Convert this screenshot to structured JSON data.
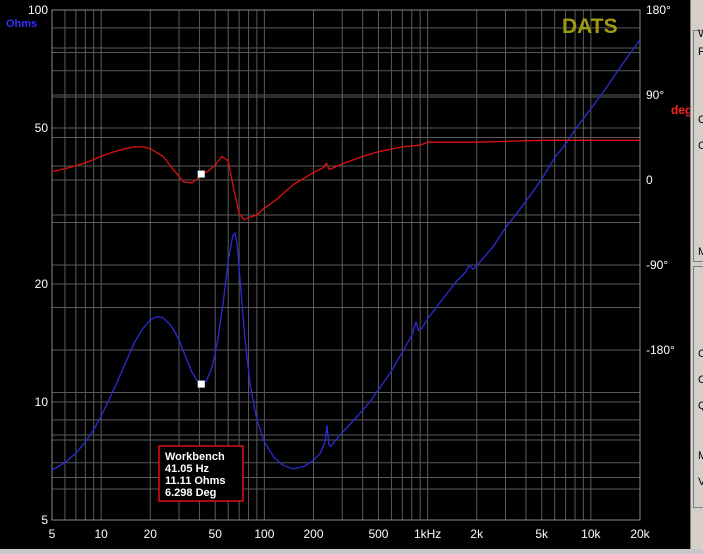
{
  "colors": {
    "impedance": "#2b2bd8",
    "phase": "#e01010",
    "grid": "#5a5a5a",
    "background": "#000000",
    "axis_text": "#ffffff",
    "ohms_label": "#3030ff",
    "deg_label": "#ff2020",
    "brand": "#a09a10",
    "cursor_box_border": "#e01010"
  },
  "chart": {
    "brand": "DATS",
    "y_left_unit": "Ohms",
    "y_right_unit": "deg",
    "left_ticks": [
      "100",
      "50",
      "20",
      "10",
      "5"
    ],
    "right_ticks": [
      "180°",
      "90°",
      "0",
      "-90°",
      "-180°"
    ],
    "x_ticks": [
      "5",
      "10",
      "20",
      "50",
      "100",
      "200",
      "500",
      "1kHz",
      "2k",
      "5k",
      "10k",
      "20k"
    ]
  },
  "cursor": {
    "title": "Workbench",
    "frequency": "41.05 Hz",
    "impedance": "11.11 Ohms",
    "phase": "6.298 Deg"
  },
  "side_panel": {
    "letters": [
      "W",
      "F",
      "C",
      "C",
      "M",
      "C",
      "C",
      "Q",
      "M",
      "V"
    ]
  },
  "chart_data": {
    "type": "line",
    "x_scale": "log",
    "xlim": [
      5,
      20000
    ],
    "ylim_left": [
      5,
      100
    ],
    "ylim_right": [
      -360,
      180
    ],
    "y_left_scale": "log",
    "grid": true,
    "series": [
      {
        "axis": "left",
        "points": [
          [
            5,
            6.7
          ],
          [
            6,
            7.0
          ],
          [
            7,
            7.4
          ],
          [
            8,
            7.9
          ],
          [
            9,
            8.5
          ],
          [
            10,
            9.2
          ],
          [
            12,
            10.8
          ],
          [
            14,
            12.5
          ],
          [
            16,
            14.2
          ],
          [
            18,
            15.4
          ],
          [
            20,
            16.2
          ],
          [
            22,
            16.5
          ],
          [
            24,
            16.4
          ],
          [
            27,
            15.6
          ],
          [
            30,
            14.4
          ],
          [
            33,
            13.0
          ],
          [
            36,
            11.9
          ],
          [
            39,
            11.3
          ],
          [
            41.05,
            11.11
          ],
          [
            44,
            11.3
          ],
          [
            48,
            12.3
          ],
          [
            52,
            14.5
          ],
          [
            56,
            18.0
          ],
          [
            60,
            23.0
          ],
          [
            64,
            26.5
          ],
          [
            66,
            27.0
          ],
          [
            68,
            25.5
          ],
          [
            72,
            19.0
          ],
          [
            76,
            14.5
          ],
          [
            82,
            11.0
          ],
          [
            90,
            9.0
          ],
          [
            100,
            7.9
          ],
          [
            115,
            7.2
          ],
          [
            130,
            6.9
          ],
          [
            150,
            6.75
          ],
          [
            175,
            6.85
          ],
          [
            200,
            7.1
          ],
          [
            220,
            7.4
          ],
          [
            235,
            7.9
          ],
          [
            242,
            8.7
          ],
          [
            248,
            7.8
          ],
          [
            255,
            7.7
          ],
          [
            280,
            8.1
          ],
          [
            320,
            8.6
          ],
          [
            380,
            9.3
          ],
          [
            450,
            10.1
          ],
          [
            520,
            11.0
          ],
          [
            600,
            12.0
          ],
          [
            700,
            13.4
          ],
          [
            800,
            14.8
          ],
          [
            850,
            16.0
          ],
          [
            880,
            15.2
          ],
          [
            920,
            15.4
          ],
          [
            1000,
            16.3
          ],
          [
            1200,
            18.0
          ],
          [
            1500,
            20.3
          ],
          [
            1700,
            21.4
          ],
          [
            1800,
            22.3
          ],
          [
            1900,
            21.8
          ],
          [
            2000,
            22.3
          ],
          [
            2500,
            24.8
          ],
          [
            3000,
            27.8
          ],
          [
            4000,
            32.5
          ],
          [
            5000,
            37.0
          ],
          [
            6000,
            42.0
          ],
          [
            7000,
            45.5
          ],
          [
            8000,
            49.5
          ],
          [
            10000,
            56.0
          ],
          [
            12000,
            62.0
          ],
          [
            15000,
            71.0
          ],
          [
            18000,
            79.0
          ],
          [
            20000,
            84.0
          ]
        ]
      },
      {
        "axis": "right",
        "points": [
          [
            5,
            9
          ],
          [
            6,
            12
          ],
          [
            8,
            18
          ],
          [
            10,
            25
          ],
          [
            12,
            30
          ],
          [
            14,
            33
          ],
          [
            16,
            35
          ],
          [
            18,
            35
          ],
          [
            20,
            33
          ],
          [
            24,
            25
          ],
          [
            28,
            10
          ],
          [
            32,
            -2
          ],
          [
            36,
            -3
          ],
          [
            40,
            3
          ],
          [
            41.05,
            6.3
          ],
          [
            45,
            9
          ],
          [
            50,
            16
          ],
          [
            55,
            25
          ],
          [
            60,
            20
          ],
          [
            65,
            -10
          ],
          [
            70,
            -35
          ],
          [
            75,
            -42
          ],
          [
            80,
            -40
          ],
          [
            90,
            -37
          ],
          [
            100,
            -30
          ],
          [
            120,
            -20
          ],
          [
            150,
            -5
          ],
          [
            200,
            8
          ],
          [
            230,
            13
          ],
          [
            240,
            18
          ],
          [
            250,
            11
          ],
          [
            300,
            17
          ],
          [
            400,
            25
          ],
          [
            500,
            30
          ],
          [
            700,
            35
          ],
          [
            900,
            37
          ],
          [
            1000,
            40
          ],
          [
            1200,
            40
          ],
          [
            1500,
            40
          ],
          [
            2000,
            40
          ],
          [
            5000,
            42
          ],
          [
            10000,
            42
          ],
          [
            20000,
            42
          ]
        ]
      }
    ],
    "markers": [
      {
        "axis": "left",
        "x": 41.05,
        "y": 11.11
      },
      {
        "axis": "right",
        "x": 41.05,
        "y": 6.298
      }
    ]
  }
}
